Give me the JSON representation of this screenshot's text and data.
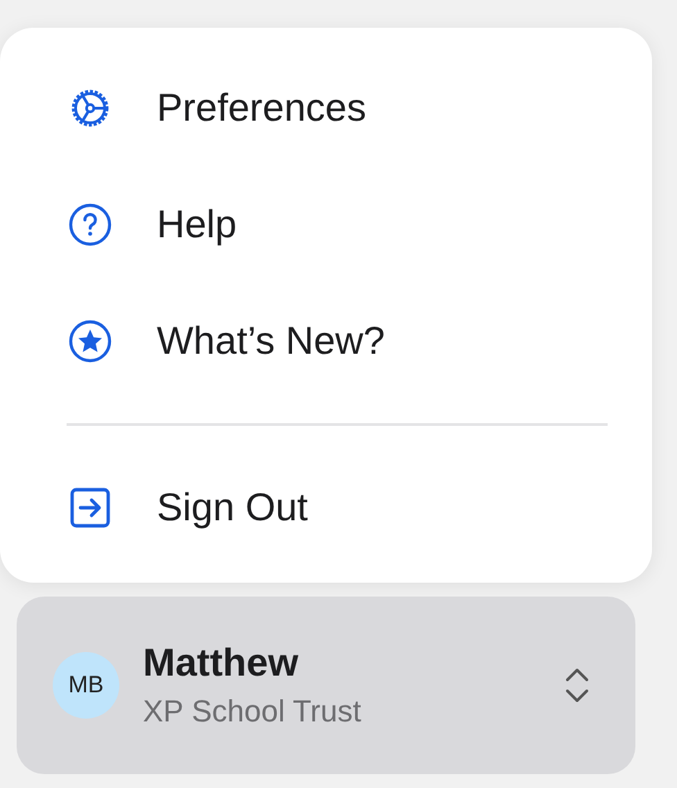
{
  "menu": {
    "groups": [
      [
        {
          "label": "Preferences"
        },
        {
          "label": "Help"
        },
        {
          "label": "What’s New?"
        }
      ],
      [
        {
          "label": "Sign Out"
        }
      ]
    ]
  },
  "account": {
    "initials": "MB",
    "name": "Matthew",
    "organization": "XP School Trust"
  }
}
